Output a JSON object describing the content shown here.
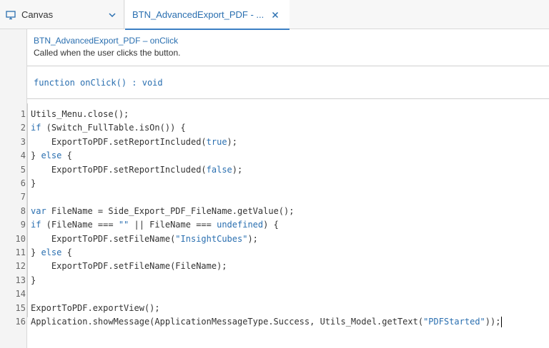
{
  "tabs": {
    "canvas_label": "Canvas",
    "active_label": "BTN_AdvancedExport_PDF - ..."
  },
  "header": {
    "title": "BTN_AdvancedExport_PDF – onClick",
    "description": "Called when the user clicks the button."
  },
  "signature": {
    "keyword": "function",
    "name": " onClick() : ",
    "return_type": "void"
  },
  "code_lines": [
    {
      "n": "1",
      "parts": [
        [
          "",
          "Utils_Menu.close();"
        ]
      ]
    },
    {
      "n": "2",
      "parts": [
        [
          "kw",
          "if"
        ],
        [
          "",
          " (Switch_FullTable.isOn()) {"
        ]
      ]
    },
    {
      "n": "3",
      "parts": [
        [
          "",
          "    ExportToPDF.setReportIncluded("
        ],
        [
          "kw",
          "true"
        ],
        [
          "",
          ");"
        ]
      ]
    },
    {
      "n": "4",
      "parts": [
        [
          "",
          "} "
        ],
        [
          "kw",
          "else"
        ],
        [
          "",
          " {"
        ]
      ]
    },
    {
      "n": "5",
      "parts": [
        [
          "",
          "    ExportToPDF.setReportIncluded("
        ],
        [
          "kw",
          "false"
        ],
        [
          "",
          ");"
        ]
      ]
    },
    {
      "n": "6",
      "parts": [
        [
          "",
          "}"
        ]
      ]
    },
    {
      "n": "7",
      "parts": [
        [
          "",
          ""
        ]
      ]
    },
    {
      "n": "8",
      "parts": [
        [
          "kw",
          "var"
        ],
        [
          "",
          " FileName = Side_Export_PDF_FileName.getValue();"
        ]
      ]
    },
    {
      "n": "9",
      "parts": [
        [
          "kw",
          "if"
        ],
        [
          "",
          " (FileName === "
        ],
        [
          "str",
          "\"\""
        ],
        [
          "",
          " || FileName === "
        ],
        [
          "kw",
          "undefined"
        ],
        [
          "",
          ") {"
        ]
      ]
    },
    {
      "n": "10",
      "parts": [
        [
          "",
          "    ExportToPDF.setFileName("
        ],
        [
          "str",
          "\"InsightCubes\""
        ],
        [
          "",
          ");"
        ]
      ]
    },
    {
      "n": "11",
      "parts": [
        [
          "",
          "} "
        ],
        [
          "kw",
          "else"
        ],
        [
          "",
          " {"
        ]
      ]
    },
    {
      "n": "12",
      "parts": [
        [
          "",
          "    ExportToPDF.setFileName(FileName);"
        ]
      ]
    },
    {
      "n": "13",
      "parts": [
        [
          "",
          "}"
        ]
      ]
    },
    {
      "n": "14",
      "parts": [
        [
          "",
          ""
        ]
      ]
    },
    {
      "n": "15",
      "parts": [
        [
          "",
          "ExportToPDF.exportView();"
        ]
      ]
    },
    {
      "n": "16",
      "parts": [
        [
          "",
          "Application.showMessage(ApplicationMessageType.Success, Utils_Model.getText("
        ],
        [
          "str",
          "\"PDFStarted\""
        ],
        [
          "",
          "));"
        ]
      ]
    }
  ],
  "colors": {
    "accent": "#2a6fb0",
    "keyword": "#2a6fb0",
    "text": "#333333"
  },
  "icons": {
    "canvas_tab": "monitor-icon",
    "dropdown": "chevron-down-icon",
    "close": "close-icon"
  }
}
